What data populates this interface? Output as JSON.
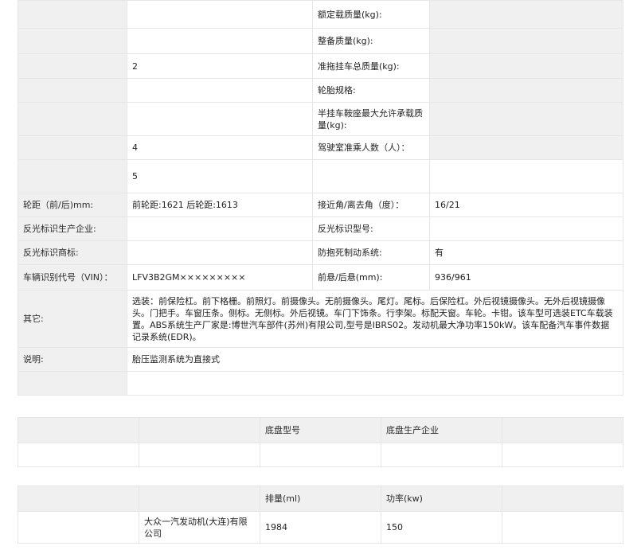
{
  "spec_rows": [
    {
      "l1": "",
      "v1": "",
      "l2": "额定载质量(kg):",
      "v2": ""
    },
    {
      "l1": "",
      "v1": "",
      "l2": "整备质量(kg):",
      "v2": ""
    },
    {
      "l1": "",
      "v1": "2",
      "l2": "准拖挂车总质量(kg):",
      "v2": ""
    },
    {
      "l1": "",
      "v1": "",
      "l2": "轮胎规格:",
      "v2": ""
    },
    {
      "l1": "",
      "v1": "",
      "l2": "半挂车鞍座最大允许承载质量(kg):",
      "v2": ""
    },
    {
      "l1": "",
      "v1": "4",
      "l2": "驾驶室准乘人数（人）：",
      "v2": ""
    },
    {
      "l1": "",
      "v1": "5",
      "l2": "",
      "v2": ""
    },
    {
      "l1": "轮距（前/后)mm:",
      "v1": "前轮距:1621 后轮距:1613",
      "l2": "接近角/离去角（度）：",
      "v2": "16/21"
    },
    {
      "l1": "反光标识生产企业:",
      "v1": "",
      "l2": "反光标识型号:",
      "v2": ""
    },
    {
      "l1": "反光标识商标:",
      "v1": "",
      "l2": "防抱死制动系统:",
      "v2": "有"
    },
    {
      "l1": "车辆识别代号（VIN）：",
      "v1": "LFV3B2GM×××××××××",
      "l2": "前悬/后悬(mm):",
      "v2": "936/961"
    }
  ],
  "other": {
    "label": "其它:",
    "text": "选装：前保险杠。前下格栅。前照灯。前摄像头。无前摄像头。尾灯。尾标。后保险杠。外后视镜摄像头。无外后视镜摄像头。门把手。车窗压条。侧标。无侧标。外后视镜。车门下饰条。行李架。标配天窗。车轮。卡钳。该车型可选装ETC车载装置。ABS系统生产厂家是:博世汽车部件(苏州)有限公司,型号是IBRS02。发动机最大净功率150kW。该车配备汽车事件数据记录系统(EDR)。"
  },
  "note": {
    "label": "说明:",
    "text": "胎压监测系统为直接式"
  },
  "chassis": {
    "headers": [
      "",
      "",
      "底盘型号",
      "底盘生产企业",
      ""
    ],
    "row": [
      "",
      "",
      "",
      "",
      ""
    ]
  },
  "engine": {
    "headers": [
      "",
      "",
      "排量(ml)",
      "功率(kw)",
      ""
    ],
    "row": [
      "",
      "大众一汽发动机(大连)有限公司",
      "1984",
      "150",
      ""
    ]
  }
}
